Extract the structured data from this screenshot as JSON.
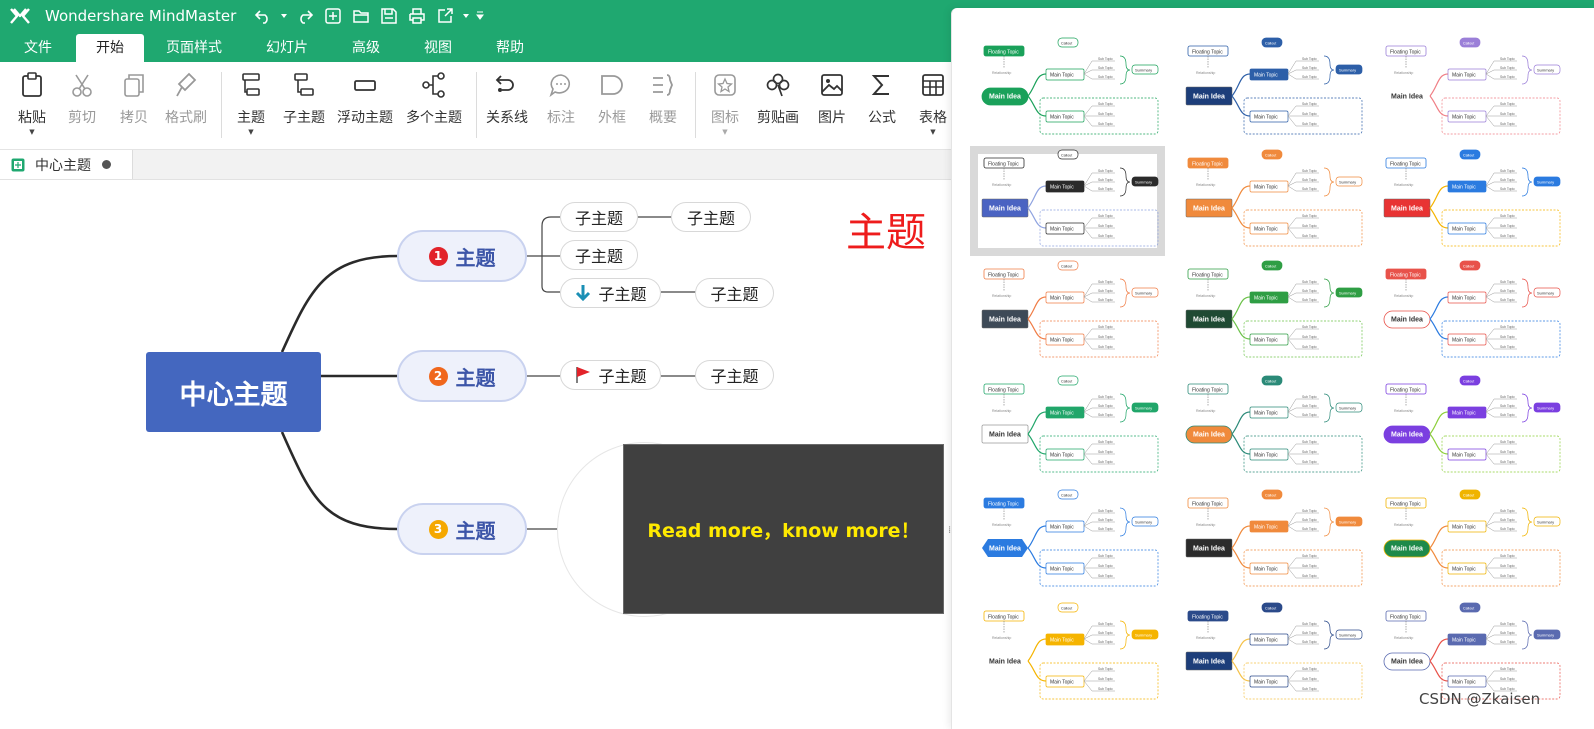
{
  "app": {
    "title": "Wondershare MindMaster"
  },
  "quick_access": [
    "undo-icon",
    "redo-icon",
    "new-icon",
    "open-folder-icon",
    "save-icon",
    "print-icon",
    "export-icon",
    "customize-icon"
  ],
  "menu": [
    "文件",
    "开始",
    "页面样式",
    "幻灯片",
    "高级",
    "视图",
    "帮助"
  ],
  "menu_active": "开始",
  "ribbon": {
    "paste": "粘贴",
    "cut": "剪切",
    "copy": "拷贝",
    "format_painter": "格式刷",
    "topic": "主题",
    "subtopic": "子主题",
    "floating_topic": "浮动主题",
    "multiple_topics": "多个主题",
    "relationship": "关系线",
    "callout": "标注",
    "boundary": "外框",
    "summary": "概要",
    "icon": "图标",
    "clipart": "剪贴画",
    "picture": "图片",
    "formula": "公式",
    "table": "表格"
  },
  "doc_tab": {
    "label": "中心主题"
  },
  "map": {
    "central": "中心主题",
    "topics": [
      {
        "num": "1",
        "label": "主题",
        "color": "#e2232a"
      },
      {
        "num": "2",
        "label": "主题",
        "color": "#f0671c"
      },
      {
        "num": "3",
        "label": "主题",
        "color": "#f5a800"
      }
    ],
    "sub_labels": [
      "子主题",
      "子主题",
      "子主题",
      "子主题",
      "子主题",
      "子主题",
      "子主题"
    ],
    "floating": "主题",
    "image_text": "Read more，know more！"
  },
  "theme_text": {
    "floating": "Floating Topic",
    "callout": "Callout",
    "main": "Main Topic",
    "idea": "Main Idea",
    "sub": "Sub Topic",
    "summary": "Summary",
    "relationship": "Relationship"
  },
  "themes": [
    {
      "accent": "#1aa15a",
      "center_bg": "#1aa15a",
      "center_fg": "#ffffff",
      "line": "#1aa15a",
      "shape": "pill"
    },
    {
      "accent": "#2d5fa8",
      "center_bg": "#1d3e7a",
      "center_fg": "#ffffff",
      "line": "#2d5fa8",
      "shape": "rect"
    },
    {
      "accent": "#9b7fd8",
      "center_bg": "#ffffff",
      "center_fg": "#333333",
      "line": "#f07f86",
      "shape": "none"
    },
    {
      "accent": "#2b2b2b",
      "center_bg": "#4a63c2",
      "center_fg": "#ffffff",
      "line": "#8fa3e0",
      "shape": "rect"
    },
    {
      "accent": "#f08a3c",
      "center_bg": "#f08a3c",
      "center_fg": "#ffffff",
      "line": "#f08a3c",
      "shape": "rect"
    },
    {
      "accent": "#2b7be0",
      "center_bg": "#e83333",
      "center_fg": "#ffffff",
      "line": "#f5b400",
      "shape": "rect"
    },
    {
      "accent": "#f07c45",
      "center_bg": "#3e4a57",
      "center_fg": "#ffffff",
      "line": "#f07c45",
      "shape": "rect"
    },
    {
      "accent": "#2f9e44",
      "center_bg": "#1f4a33",
      "center_fg": "#ffffff",
      "line": "#6cc24a",
      "shape": "rect"
    },
    {
      "accent": "#e8524a",
      "center_bg": "#ffffff",
      "center_fg": "#333333",
      "line": "#2b7be0",
      "shape": "pill"
    },
    {
      "accent": "#21a66a",
      "center_bg": "#ffffff",
      "center_fg": "#333333",
      "line": "#21a66a",
      "shape": "rect"
    },
    {
      "accent": "#2b8a78",
      "center_bg": "#f08a3c",
      "center_fg": "#ffffff",
      "line": "#2b8a78",
      "shape": "pill"
    },
    {
      "accent": "#7b3fe0",
      "center_bg": "#7b3fe0",
      "center_fg": "#ffffff",
      "line": "#8ccf3a",
      "shape": "pill"
    },
    {
      "accent": "#2b7be0",
      "center_bg": "#2b7be0",
      "center_fg": "#ffffff",
      "line": "#2b7be0",
      "shape": "hex"
    },
    {
      "accent": "#f08a3c",
      "center_bg": "#2b2b2b",
      "center_fg": "#ffffff",
      "line": "#f08a3c",
      "shape": "rect"
    },
    {
      "accent": "#f0b400",
      "center_bg": "#1e8a4a",
      "center_fg": "#ffffff",
      "line": "#f08a3c",
      "shape": "pill"
    },
    {
      "accent": "#f5b400",
      "center_bg": "#ffffff",
      "center_fg": "#333333",
      "line": "#f5b400",
      "shape": "none"
    },
    {
      "accent": "#2b4a8a",
      "center_bg": "#1d3e7a",
      "center_fg": "#ffffff",
      "line": "#f5c24a",
      "shape": "rect"
    },
    {
      "accent": "#5a6ab0",
      "center_bg": "#ffffff",
      "center_fg": "#333333",
      "line": "#e8524a",
      "shape": "pill"
    }
  ],
  "selected_theme": 3,
  "watermark": "CSDN @Zkaisen"
}
